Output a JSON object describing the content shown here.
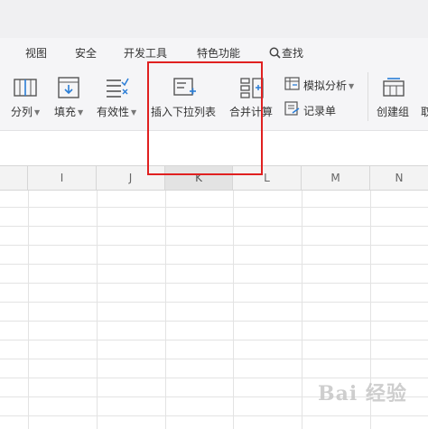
{
  "menu_tabs": [
    "视图",
    "安全",
    "开发工具",
    "特色功能",
    "查找"
  ],
  "ribbon": {
    "split": "分列",
    "fill": "填充",
    "validity": "有效性",
    "insert_dropdown": "插入下拉列表",
    "merge_calc": "合并计算",
    "simulate_analysis": "模拟分析",
    "record_form": "记录单",
    "create_group": "创建组",
    "partial_next": "取"
  },
  "columns": [
    "I",
    "J",
    "K",
    "L",
    "M",
    "N"
  ],
  "selected_column": "K",
  "highlight_color": "#e02020",
  "watermark": "Bai 经验"
}
